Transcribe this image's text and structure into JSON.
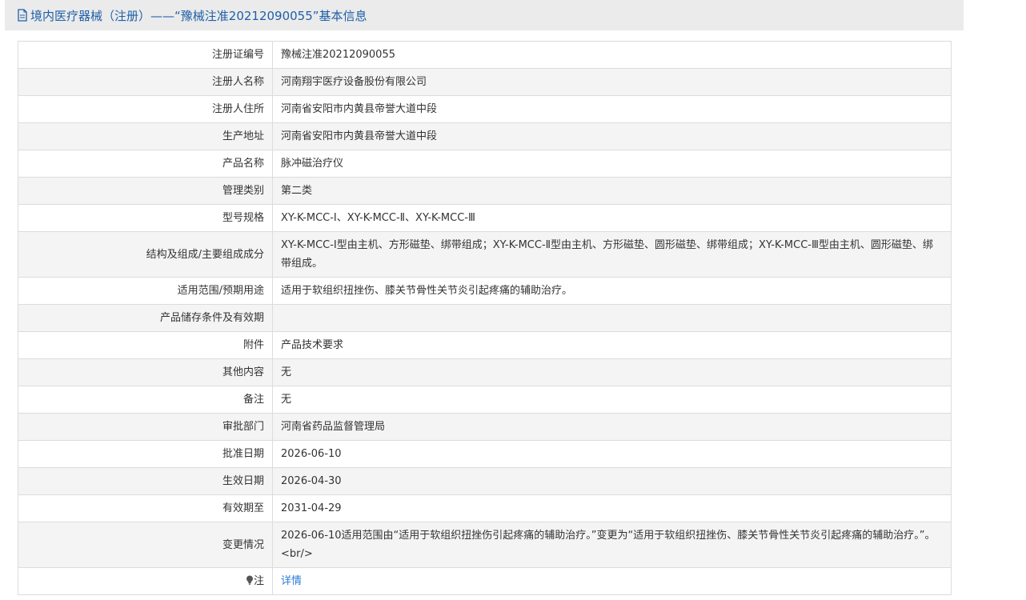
{
  "header": {
    "title": "境内医疗器械（注册）——“豫械注准20212090055”基本信息",
    "icon": "document-icon"
  },
  "rows": [
    {
      "label": "注册证编号",
      "value": "豫械注准20212090055"
    },
    {
      "label": "注册人名称",
      "value": "河南翔宇医疗设备股份有限公司"
    },
    {
      "label": "注册人住所",
      "value": "河南省安阳市内黄县帝誉大道中段"
    },
    {
      "label": "生产地址",
      "value": "河南省安阳市内黄县帝誉大道中段"
    },
    {
      "label": "产品名称",
      "value": "脉冲磁治疗仪"
    },
    {
      "label": "管理类别",
      "value": "第二类"
    },
    {
      "label": "型号规格",
      "value": "XY-K-MCC-Ⅰ、XY-K-MCC-Ⅱ、XY-K-MCC-Ⅲ"
    },
    {
      "label": "结构及组成/主要组成成分",
      "value": "XY-K-MCC-Ⅰ型由主机、方形磁垫、绑带组成；XY-K-MCC-Ⅱ型由主机、方形磁垫、圆形磁垫、绑带组成；XY-K-MCC-Ⅲ型由主机、圆形磁垫、绑带组成。"
    },
    {
      "label": "适用范围/预期用途",
      "value": "适用于软组织扭挫伤、膝关节骨性关节炎引起疼痛的辅助治疗。"
    },
    {
      "label": "产品储存条件及有效期",
      "value": ""
    },
    {
      "label": "附件",
      "value": "产品技术要求"
    },
    {
      "label": "其他内容",
      "value": "无"
    },
    {
      "label": "备注",
      "value": "无"
    },
    {
      "label": "审批部门",
      "value": "河南省药品监督管理局"
    },
    {
      "label": "批准日期",
      "value": "2026-06-10"
    },
    {
      "label": "生效日期",
      "value": "2026-04-30"
    },
    {
      "label": "有效期至",
      "value": "2031-04-29"
    },
    {
      "label": "变更情况",
      "value": "2026-06-10适用范围由“适用于软组织扭挫伤引起疼痛的辅助治疗。”变更为“适用于软组织扭挫伤、膝关节骨性关节炎引起疼痛的辅助治疗。”。<br/>"
    }
  ],
  "note": {
    "label": "注",
    "icon": "lightbulb-icon",
    "link_text": "详情"
  },
  "colors": {
    "header_background": "#ebebeb",
    "header_text": "#1f5fa8",
    "link": "#2a7bd4",
    "border": "#dcdcdc",
    "stripe": "#f4f4f4"
  }
}
